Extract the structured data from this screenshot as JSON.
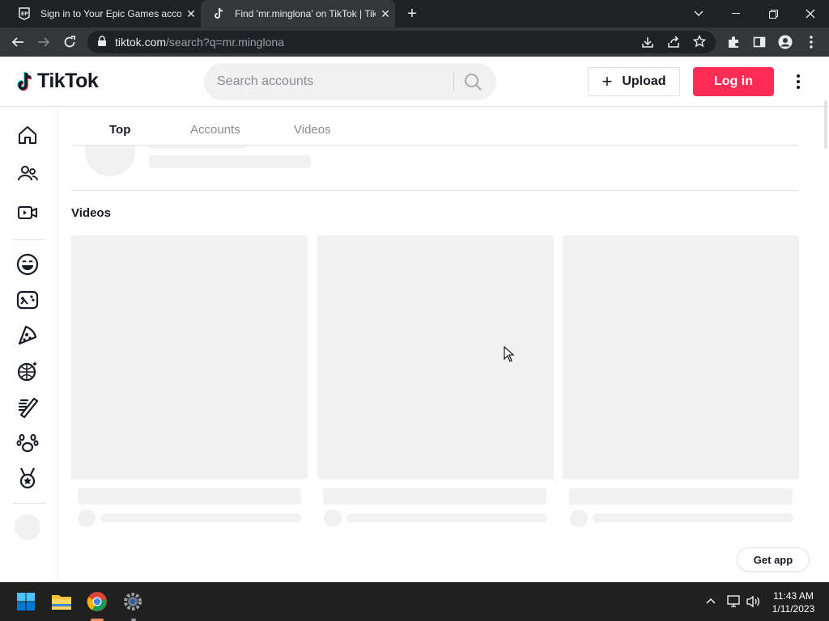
{
  "browser": {
    "tabs": [
      {
        "title": "Sign in to Your Epic Games accou",
        "favicon": "epic-games-icon",
        "active": false
      },
      {
        "title": "Find 'mr.minglona' on TikTok | Tik",
        "favicon": "tiktok-icon",
        "active": true
      }
    ],
    "url_host": "tiktok.com",
    "url_path": "/search?q=mr.minglona"
  },
  "header": {
    "logo_text": "TikTok",
    "search_placeholder": "Search accounts",
    "upload_label": "Upload",
    "login_label": "Log in",
    "accent": "#fe2c55"
  },
  "search_tabs": [
    {
      "label": "Top",
      "active": true
    },
    {
      "label": "Accounts",
      "active": false
    },
    {
      "label": "Videos",
      "active": false
    }
  ],
  "videos_section": {
    "title": "Videos"
  },
  "sidebar": {
    "icons": [
      "home-icon",
      "following-icon",
      "live-icon",
      "comedy-icon",
      "gaming-icon",
      "food-icon",
      "dance-icon",
      "beauty-icon",
      "animals-icon",
      "sports-icon"
    ]
  },
  "get_app_label": "Get app",
  "taskbar": {
    "time": "11:43 AM",
    "date": "1/11/2023"
  }
}
